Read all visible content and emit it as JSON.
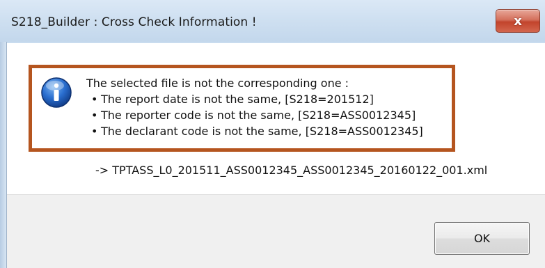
{
  "window": {
    "title": "S218_Builder : Cross Check Information !",
    "close_glyph": "x"
  },
  "message": {
    "heading": "The selected file is not the corresponding one :",
    "bullet_glyph": "•",
    "bullets": [
      "The report date is not the same, [S218=201512]",
      "The reporter code is not the same, [S218=ASS0012345]",
      "The declarant code is not the same, [S218=ASS0012345]"
    ],
    "filename_line": "-> TPTASS_L0_201511_ASS0012345_ASS0012345_20160122_001.xml"
  },
  "buttons": {
    "ok_label": "OK"
  },
  "icons": {
    "info": "info-icon",
    "close": "close-icon"
  },
  "colors": {
    "highlight_border": "#b5551f",
    "close_button": "#c2442c",
    "info_icon": "#1f5fb8"
  }
}
